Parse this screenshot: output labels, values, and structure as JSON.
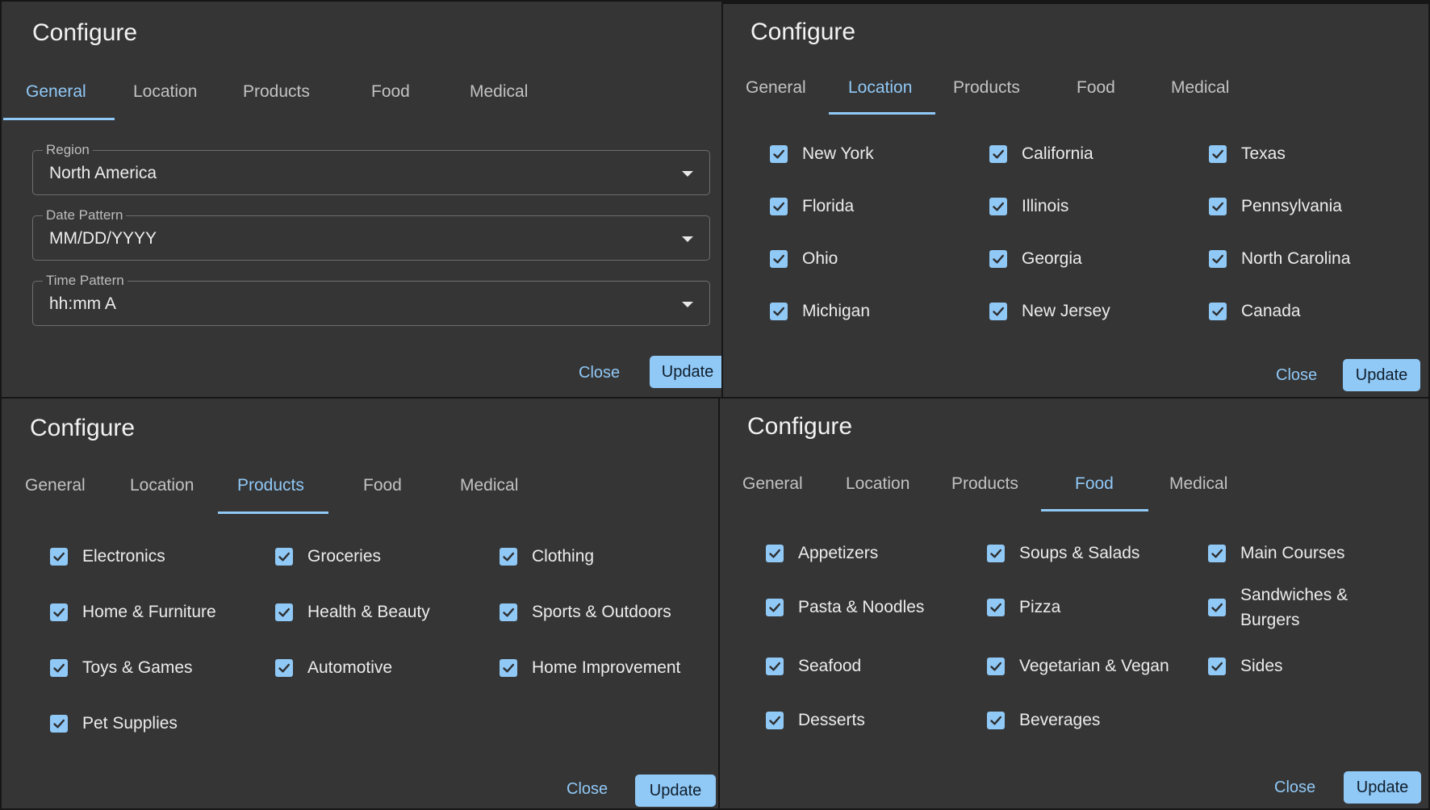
{
  "dialogs": [
    {
      "title": "Configure",
      "tabs": [
        "General",
        "Location",
        "Products",
        "Food",
        "Medical"
      ],
      "active_tab": "General",
      "fields": [
        {
          "label": "Region",
          "value": "North America"
        },
        {
          "label": "Date Pattern",
          "value": "MM/DD/YYYY"
        },
        {
          "label": "Time Pattern",
          "value": "hh:mm A"
        }
      ],
      "close_label": "Close",
      "update_label": "Update"
    },
    {
      "title": "Configure",
      "tabs": [
        "General",
        "Location",
        "Products",
        "Food",
        "Medical"
      ],
      "active_tab": "Location",
      "checkboxes": [
        {
          "label": "New York",
          "checked": true
        },
        {
          "label": "California",
          "checked": true
        },
        {
          "label": "Texas",
          "checked": true
        },
        {
          "label": "Florida",
          "checked": true
        },
        {
          "label": "Illinois",
          "checked": true
        },
        {
          "label": "Pennsylvania",
          "checked": true
        },
        {
          "label": "Ohio",
          "checked": true
        },
        {
          "label": "Georgia",
          "checked": true
        },
        {
          "label": "North Carolina",
          "checked": true
        },
        {
          "label": "Michigan",
          "checked": true
        },
        {
          "label": "New Jersey",
          "checked": true
        },
        {
          "label": "Canada",
          "checked": true
        }
      ],
      "close_label": "Close",
      "update_label": "Update"
    },
    {
      "title": "Configure",
      "tabs": [
        "General",
        "Location",
        "Products",
        "Food",
        "Medical"
      ],
      "active_tab": "Products",
      "checkboxes": [
        {
          "label": "Electronics",
          "checked": true
        },
        {
          "label": "Groceries",
          "checked": true
        },
        {
          "label": "Clothing",
          "checked": true
        },
        {
          "label": "Home & Furniture",
          "checked": true
        },
        {
          "label": "Health & Beauty",
          "checked": true
        },
        {
          "label": "Sports & Outdoors",
          "checked": true
        },
        {
          "label": "Toys & Games",
          "checked": true
        },
        {
          "label": "Automotive",
          "checked": true
        },
        {
          "label": "Home Improvement",
          "checked": true
        },
        {
          "label": "Pet Supplies",
          "checked": true
        }
      ],
      "close_label": "Close",
      "update_label": "Update"
    },
    {
      "title": "Configure",
      "tabs": [
        "General",
        "Location",
        "Products",
        "Food",
        "Medical"
      ],
      "active_tab": "Food",
      "checkboxes": [
        {
          "label": "Appetizers",
          "checked": true
        },
        {
          "label": "Soups & Salads",
          "checked": true
        },
        {
          "label": "Main Courses",
          "checked": true
        },
        {
          "label": "Pasta & Noodles",
          "checked": true
        },
        {
          "label": "Pizza",
          "checked": true
        },
        {
          "label": "Sandwiches & Burgers",
          "checked": true
        },
        {
          "label": "Seafood",
          "checked": true
        },
        {
          "label": "Vegetarian & Vegan",
          "checked": true
        },
        {
          "label": "Sides",
          "checked": true
        },
        {
          "label": "Desserts",
          "checked": true
        },
        {
          "label": "Beverages",
          "checked": true
        }
      ],
      "close_label": "Close",
      "update_label": "Update"
    }
  ]
}
